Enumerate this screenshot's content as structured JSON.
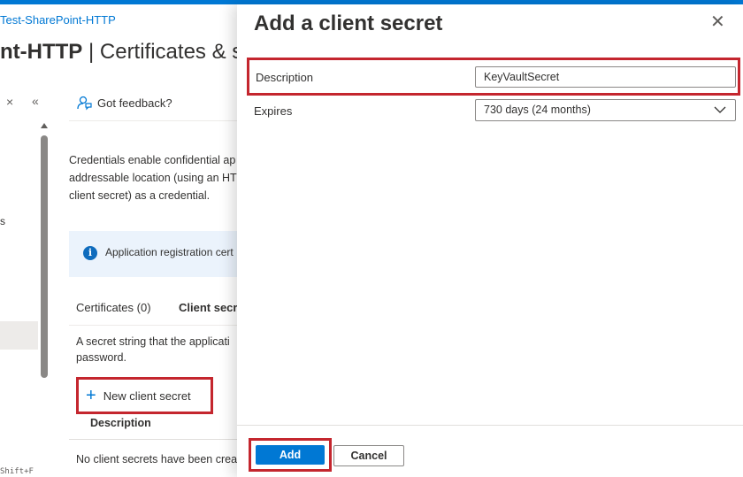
{
  "breadcrumb": "Test-SharePoint-HTTP",
  "page_title": {
    "bold_part": "nt-HTTP",
    "rest": " | Certificates & se"
  },
  "left_nav": {
    "close_glyph": "×",
    "collapse_glyph": "«",
    "fragment_s": "s",
    "shortcut_fragment": "Shift+F"
  },
  "feedback_label": "Got feedback?",
  "credentials_text": [
    "Credentials enable confidential ap",
    "addressable location (using an HT",
    "client secret) as a credential."
  ],
  "info_banner_text": "Application registration cert",
  "tabs": {
    "certificates": "Certificates (0)",
    "client_secrets": "Client secre"
  },
  "secret_description": [
    "A secret string that the applicati",
    "password."
  ],
  "new_client_secret_label": "New client secret",
  "table": {
    "column_description": "Description",
    "empty_text": "No client secrets have been crea"
  },
  "pane": {
    "title": "Add a client secret",
    "close_glyph": "✕",
    "description_label": "Description",
    "description_value": "KeyVaultSecret",
    "expires_label": "Expires",
    "expires_value": "730 days (24 months)",
    "add_label": "Add",
    "cancel_label": "Cancel"
  },
  "colors": {
    "accent": "#0078d4",
    "highlight": "#c4262e"
  }
}
